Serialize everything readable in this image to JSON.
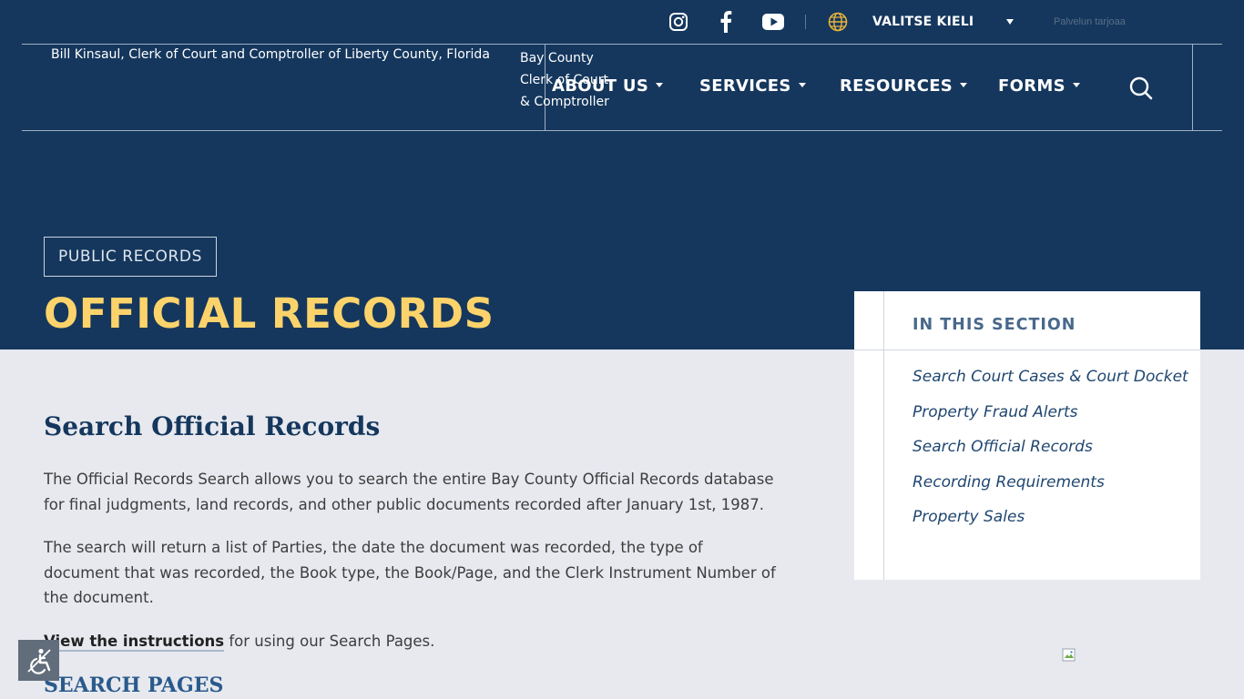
{
  "topbar": {
    "social": [
      "instagram-icon",
      "facebook-icon",
      "youtube-icon"
    ],
    "language_label": "VALITSE KIELI",
    "powered_by": "Palvelun tarjoaa"
  },
  "header": {
    "logo_alt": "Bill Kinsaul, Clerk of Court and Comptroller of Liberty County, Florida",
    "logo2_alt": "Bay County Clerk of Court & Comptroller"
  },
  "nav": {
    "items": [
      {
        "label": "ABOUT US"
      },
      {
        "label": "SERVICES"
      },
      {
        "label": "RESOURCES"
      },
      {
        "label": "FORMS"
      }
    ]
  },
  "hero": {
    "breadcrumb": "PUBLIC RECORDS",
    "title": "OFFICIAL RECORDS"
  },
  "content": {
    "heading": "Search Official Records",
    "para1": "The Official Records Search allows you to search the entire Bay County Official Records database for final judgments, land records, and other public documents recorded after January 1st, 1987.",
    "para2": "The search will return a list of Parties, the date the document was recorded, the type of document that was recorded, the Book type, the Book/Page, and the Clerk Instrument Number of the document.",
    "instructions_link": "View the instructions",
    "instructions_rest": " for using our Search Pages.",
    "subheading": "SEARCH PAGES"
  },
  "sidebar": {
    "title": "IN THIS SECTION",
    "links": [
      "Search Court Cases & Court Docket",
      "Property Fraud Alerts",
      "Search Official Records",
      "Recording Requirements",
      "Property Sales"
    ]
  },
  "colors": {
    "header_bg": "#15375d",
    "title_yellow": "#fcd36b",
    "page_bg": "#e7e9ef"
  }
}
